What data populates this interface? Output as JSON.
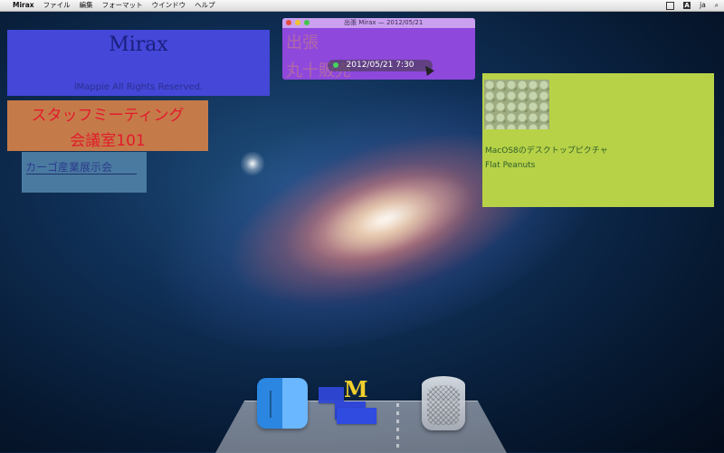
{
  "menubar": {
    "apple_label": "",
    "app_name": "Mirax",
    "menus": [
      "ファイル",
      "編集",
      "フォーマット",
      "ウインドウ",
      "ヘルプ"
    ],
    "input_indicator": "A",
    "language": "ja"
  },
  "notes": {
    "blue": {
      "title": "Mirax",
      "subtitle": "iMappie All Rights Reserved."
    },
    "orange": {
      "line1": "スタッフミーティング",
      "line2": "会議室101"
    },
    "steel": {
      "text": "カーゴ産業展示会"
    },
    "purple": {
      "window_title": "出張 Mirax — 2012/05/21",
      "line1": "出張",
      "line2": "丸十販売",
      "date": "2012/05/21 7:30"
    },
    "green": {
      "caption1": "MacOS8のデスクトップピクチャ",
      "caption2": "Flat Peanuts"
    }
  },
  "dock": {
    "items": [
      "finder",
      "mirax",
      "trash"
    ],
    "mirax_letter": "M"
  },
  "colors": {
    "note_blue": "#4447d8",
    "note_orange": "#c57a4a",
    "note_steel": "#4a7aa0",
    "note_purple": "#8f48dc",
    "note_green": "#b7d247"
  }
}
